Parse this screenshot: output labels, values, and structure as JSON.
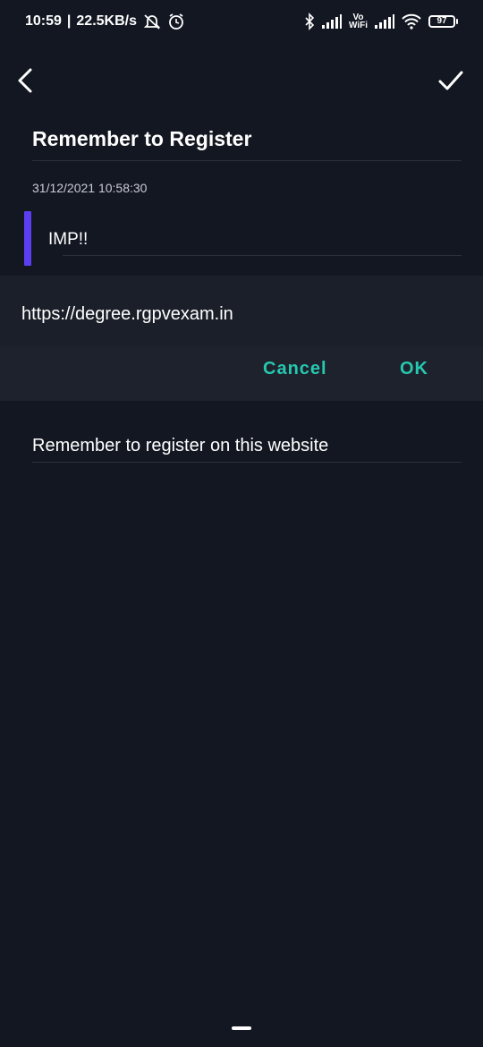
{
  "status_bar": {
    "time": "10:59",
    "speed": "22.5KB/s",
    "vo_label": "Vo",
    "wifi_label": "WiFi",
    "battery": "97"
  },
  "note": {
    "title": "Remember to Register",
    "timestamp": "31/12/2021 10:58:30",
    "tag": "IMP!!",
    "body": "Remember to register on this website",
    "priority_color": "#5b3ef0"
  },
  "link_dialog": {
    "url": "https://degree.rgpvexam.in",
    "cancel_label": "Cancel",
    "ok_label": "OK",
    "accent_color": "#26c8b0"
  },
  "icons": {
    "back": "chevron-left-icon",
    "save": "checkmark-icon"
  }
}
